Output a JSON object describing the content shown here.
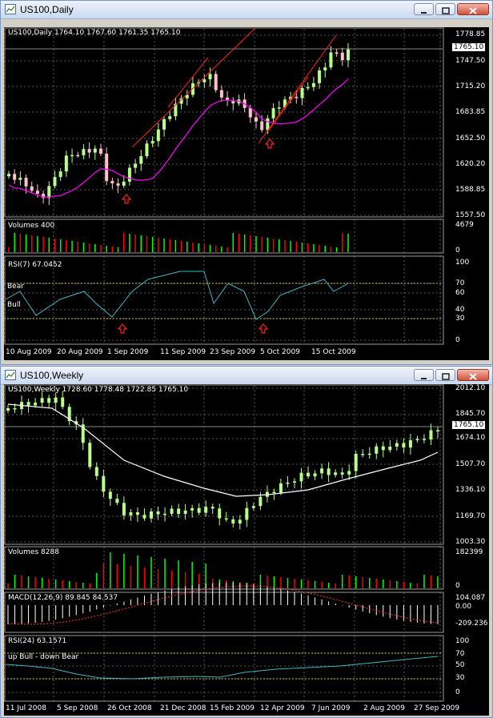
{
  "windows": [
    {
      "title": "US100,Daily",
      "main_label": "US100,Daily  1764.10 1767.60 1761.35 1765.10",
      "current_price": "1765.10",
      "price_ticks": [
        "1778.85",
        "1747.50",
        "1715.20",
        "1683.85",
        "1652.50",
        "1620.20",
        "1588.85",
        "1557.50"
      ],
      "panels": [
        {
          "label": "Volumes 400",
          "ticks": [
            "4679",
            "0"
          ]
        },
        {
          "label": "RSI(7) 67.0452",
          "ticks": [
            "100",
            "70",
            "60",
            "40",
            "30",
            "0"
          ],
          "text_labels": [
            "Bear",
            "Bull"
          ]
        }
      ],
      "dates": [
        "10 Aug 2009",
        "20 Aug 2009",
        "1 Sep 2009",
        "11 Sep 2009",
        "23 Sep 2009",
        "5 Oct 2009",
        "15 Oct 2009"
      ]
    },
    {
      "title": "US100,Weekly",
      "main_label": "US100,Weekly  1728.60 1778.48 1722.85 1765.10",
      "current_price": "1765.10",
      "price_ticks": [
        "2012.10",
        "1845.70",
        "1674.10",
        "1507.70",
        "1336.10",
        "1169.70",
        "1003.30"
      ],
      "panels": [
        {
          "label": "Volumes 8288",
          "ticks": [
            "182399",
            "0"
          ]
        },
        {
          "label": "MACD(12,26,9) 89.845 84.537",
          "ticks": [
            "104.087",
            "0.00",
            "-209.236"
          ]
        },
        {
          "label": "RSI(24) 63.1571",
          "ticks": [
            "100",
            "70",
            "50",
            "30",
            "0"
          ],
          "text_labels": [
            "up Bull - down Bear"
          ]
        }
      ],
      "dates": [
        "11 Jul 2008",
        "5 Sep 2008",
        "26 Oct 2008",
        "21 Dec 2008",
        "15 Feb 2009",
        "12 Apr 2009",
        "7 Jun 2009",
        "2 Aug 2009",
        "27 Sep 2009"
      ]
    }
  ],
  "colors": {
    "bull": "#00ff00",
    "bear": "#ff0000",
    "daily_body_bull": "#b6ff8a",
    "daily_body_bear": "#ffc0cb",
    "ma_daily": "#ff00ff",
    "ma_weekly": "#ffffff",
    "rsi": "#3fb6c4",
    "grid": "#5a5a5a",
    "trend": "#ff2020"
  },
  "icons": [
    "chart-window-icon",
    "minimize-icon",
    "restore-icon",
    "close-icon",
    "up-arrow-signal-icon"
  ]
}
